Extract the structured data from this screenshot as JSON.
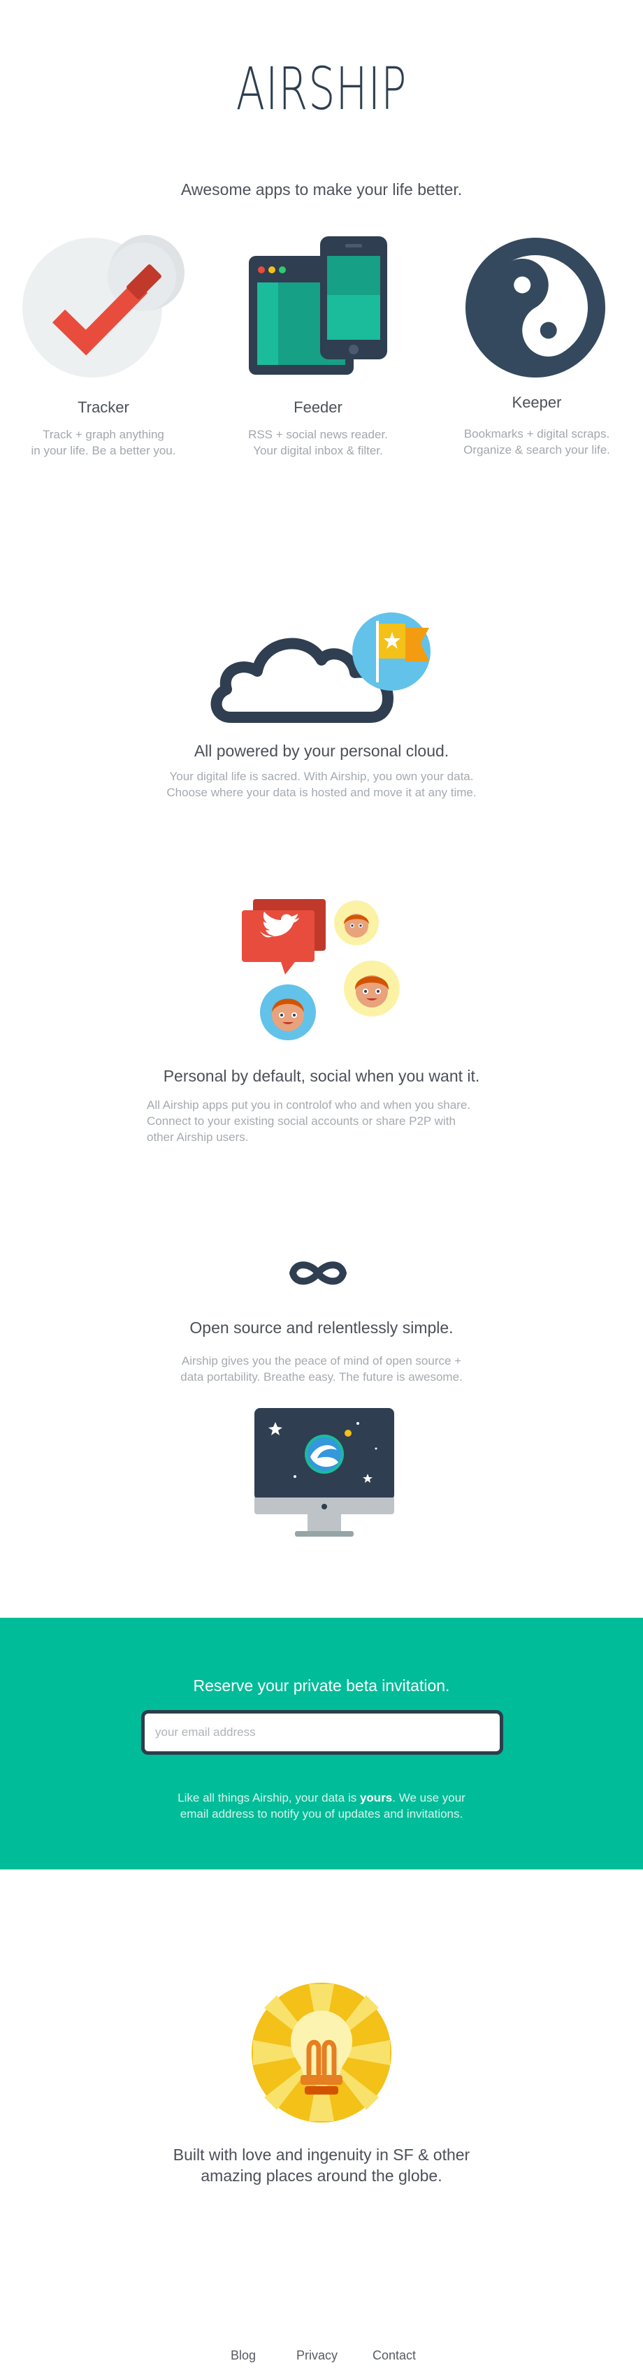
{
  "header": {
    "logo": "AIRSHIP",
    "tagline": "Awesome apps to make your life better."
  },
  "apps": [
    {
      "icon": "tracker-checkmark-icon",
      "title": "Tracker",
      "desc_line1": "Track + graph anything",
      "desc_line2": "in your life. Be a better you."
    },
    {
      "icon": "feeder-devices-icon",
      "title": "Feeder",
      "desc_line1": "RSS + social news reader.",
      "desc_line2": "Your digital inbox & filter."
    },
    {
      "icon": "keeper-yin-yang-icon",
      "title": "Keeper",
      "desc_line1": "Bookmarks + digital scraps.",
      "desc_line2": "Organize & search your life."
    }
  ],
  "cloud": {
    "icon": "cloud-flag-icon",
    "title": "All powered by your personal cloud.",
    "desc_line1": "Your digital life is sacred. With Airship, you own your data.",
    "desc_line2": "Choose where your data is hosted and move it at any time."
  },
  "social": {
    "icon": "social-people-icon",
    "title": "Personal by default, social when you want it.",
    "desc_line1": "All Airship apps put you in controlof who and when you share.",
    "desc_line2": "Connect to your existing social accounts or share P2P with",
    "desc_line3": "other Airship users."
  },
  "opensource": {
    "icon": "infinity-icon",
    "title": "Open source and relentlessly simple.",
    "desc_line1": "Airship gives you the peace of mind of open source +",
    "desc_line2": "data portability. Breathe easy. The future is awesome."
  },
  "beta": {
    "title": "Reserve your private beta invitation.",
    "email_placeholder": "your email address",
    "email_value": "",
    "note_before": "Like all things Airship, your data is ",
    "note_bold": "yours",
    "note_after": ". We use your",
    "note_line2": "email address to notify you of updates and invitations."
  },
  "built": {
    "icon": "lightbulb-icon",
    "line1": "Built with love and ingenuity in SF & other",
    "line2": "amazing places around the globe."
  },
  "footer": {
    "links": [
      "Blog",
      "Privacy",
      "Contact"
    ]
  },
  "colors": {
    "navy": "#2f3e50",
    "teal": "#00bc99",
    "red": "#e84c3d",
    "yellow": "#f3c118",
    "sky": "#62c2ea",
    "orange": "#f39c12"
  }
}
